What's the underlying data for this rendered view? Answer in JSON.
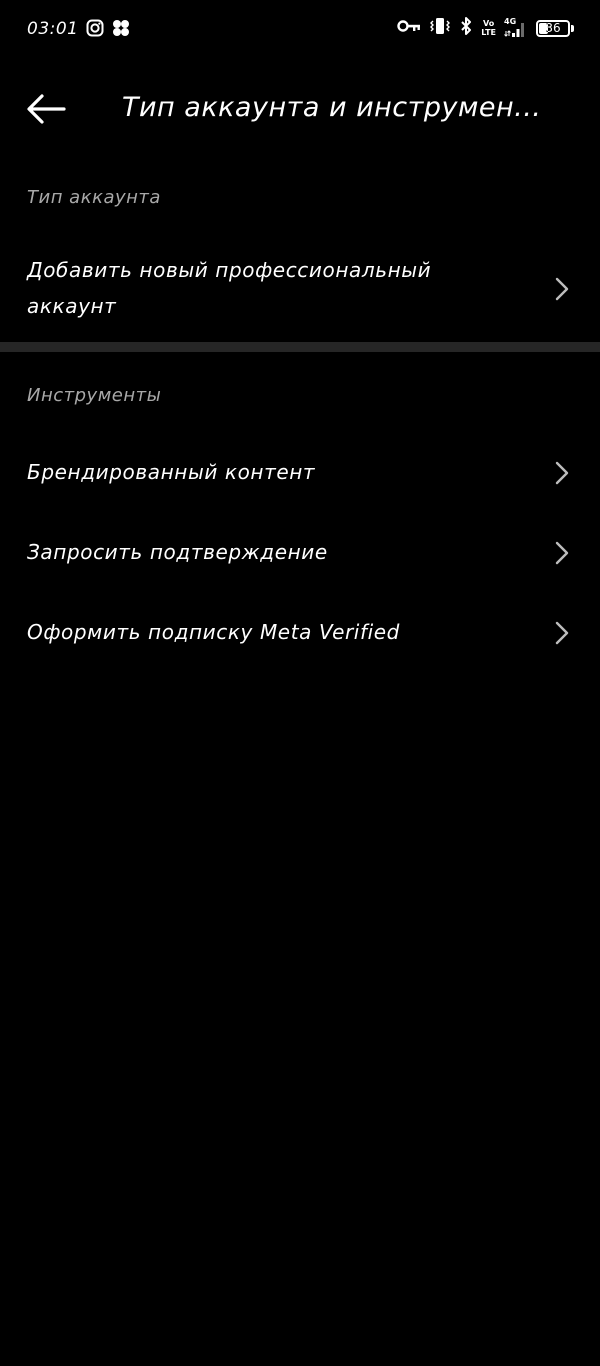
{
  "status_bar": {
    "time": "03:01",
    "left_icons": [
      "instagram-icon",
      "pinwheel-icon"
    ],
    "right_icons": [
      "key-icon",
      "vibrate-icon",
      "bluetooth-icon",
      "volte-icon",
      "signal-icon",
      "battery-icon"
    ],
    "volte_top": "Vo",
    "volte_bottom": "LTE",
    "network": "4G",
    "battery_level": "36",
    "battery_fraction": 0.36
  },
  "header": {
    "back_icon": "arrow-left-icon",
    "title": "Тип аккаунта и инструмен..."
  },
  "sections": [
    {
      "title": "Тип аккаунта",
      "items": [
        {
          "label": "Добавить новый профессиональный аккаунт",
          "icon": "chevron-right-icon"
        }
      ]
    },
    {
      "title": "Инструменты",
      "items": [
        {
          "label": "Брендированный контент",
          "icon": "chevron-right-icon"
        },
        {
          "label": "Запросить подтверждение",
          "icon": "chevron-right-icon"
        },
        {
          "label": "Оформить подписку Meta Verified",
          "icon": "chevron-right-icon"
        }
      ]
    }
  ],
  "colors": {
    "background": "#000000",
    "text_primary": "#ffffff",
    "text_secondary": "#a8a8a8",
    "divider": "#262626",
    "chevron": "#bdbdbd"
  }
}
